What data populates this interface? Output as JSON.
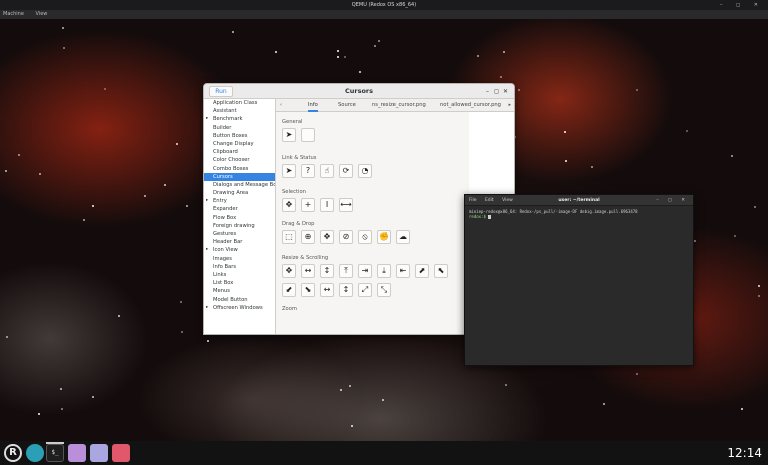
{
  "qemu": {
    "title": "QEMU (Redox OS x86_64)",
    "menu": [
      "Machine",
      "View"
    ],
    "controls": "– ◻ ✕"
  },
  "gtk_window": {
    "run_label": "Run",
    "title": "Cursors",
    "demo_list": [
      {
        "label": "Application Class",
        "expandable": false
      },
      {
        "label": "Assistant",
        "expandable": false
      },
      {
        "label": "Benchmark",
        "expandable": true
      },
      {
        "label": "Builder",
        "expandable": false
      },
      {
        "label": "Button Boxes",
        "expandable": false
      },
      {
        "label": "Change Display",
        "expandable": false
      },
      {
        "label": "Clipboard",
        "expandable": false
      },
      {
        "label": "Color Chooser",
        "expandable": false
      },
      {
        "label": "Combo Boxes",
        "expandable": false
      },
      {
        "label": "Cursors",
        "expandable": false,
        "selected": true
      },
      {
        "label": "Dialogs and Message Boxes",
        "expandable": false
      },
      {
        "label": "Drawing Area",
        "expandable": false
      },
      {
        "label": "Entry",
        "expandable": true
      },
      {
        "label": "Expander",
        "expandable": false
      },
      {
        "label": "Flow Box",
        "expandable": false
      },
      {
        "label": "Foreign drawing",
        "expandable": false
      },
      {
        "label": "Gestures",
        "expandable": false
      },
      {
        "label": "Header Bar",
        "expandable": false
      },
      {
        "label": "Icon View",
        "expandable": true
      },
      {
        "label": "Images",
        "expandable": false
      },
      {
        "label": "Info Bars",
        "expandable": false
      },
      {
        "label": "Links",
        "expandable": false
      },
      {
        "label": "List Box",
        "expandable": false
      },
      {
        "label": "Menus",
        "expandable": false
      },
      {
        "label": "Model Button",
        "expandable": false
      },
      {
        "label": "Offscreen Windows",
        "expandable": true
      }
    ],
    "tabs": [
      "Info",
      "Source",
      "ns_resize_cursor.png",
      "not_allowed_cursor.png"
    ],
    "active_tab": "Info",
    "sections": {
      "general": "General",
      "link_status": "Link & Status",
      "selection": "Selection",
      "drag_drop": "Drag & Drop",
      "resize_scrolling": "Resize & Scrolling",
      "zoom": "Zoom"
    },
    "cursor_icons": {
      "general": [
        "➤",
        ""
      ],
      "link_status": [
        "➤",
        "?",
        "☝",
        "⟳",
        "◔"
      ],
      "selection": [
        "✥",
        "+",
        "I",
        "⟷"
      ],
      "drag_drop": [
        "⬚",
        "⊕",
        "✥",
        "⊘",
        "⦸",
        "✊",
        "☁"
      ],
      "resize_row1": [
        "✥",
        "↔",
        "↕",
        "⤒",
        "⇥",
        "⤓",
        "⇤",
        "⬈",
        "⬉"
      ],
      "resize_row2": [
        "⬋",
        "⬊",
        "↔",
        "↕",
        "⤢",
        "⤡"
      ]
    }
  },
  "terminal": {
    "menu": [
      "File",
      "Edit",
      "View"
    ],
    "title": "user: ~/terminal",
    "controls": "– ◻ ✕",
    "line1": "miniep-redox@x86_64: Redox-/ps_pull/-image-DF debig.image.pull.6963478",
    "prompt": "redox:$"
  },
  "taskbar": {
    "logo_letter": "R",
    "term_glyph": "$_",
    "clock": "12:14"
  }
}
